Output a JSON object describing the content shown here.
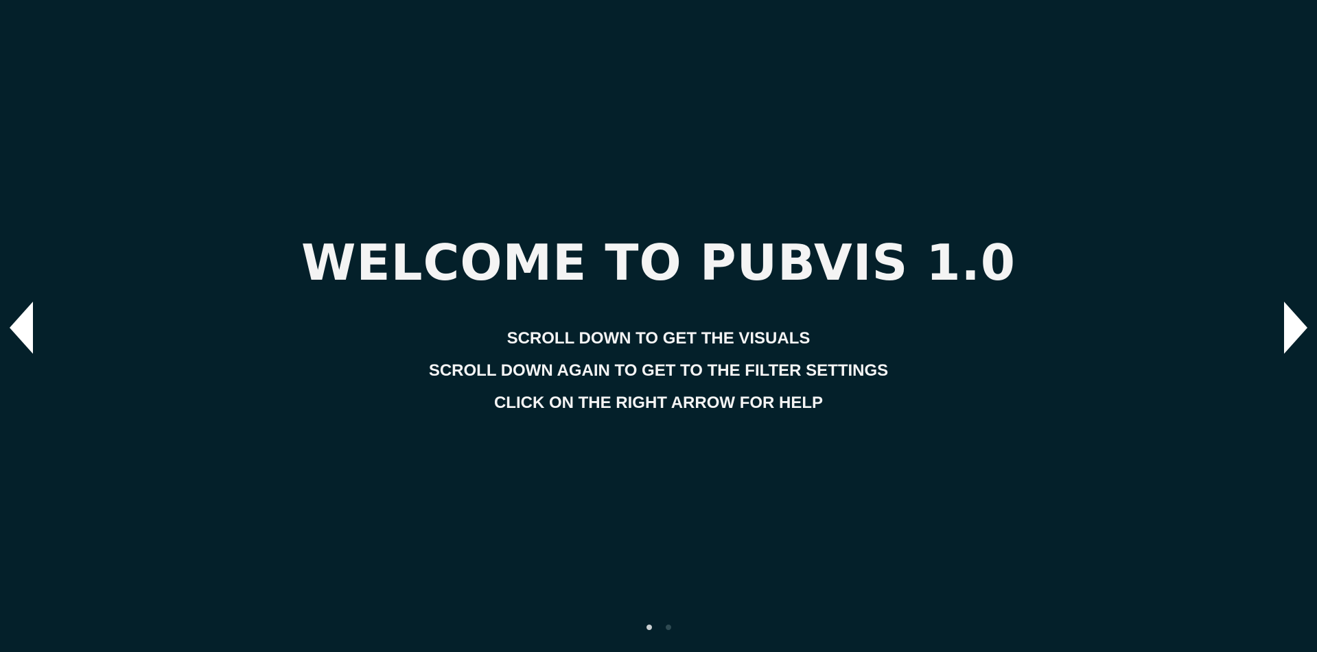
{
  "slide": {
    "title": "Welcome to PubVis 1.0",
    "lines": [
      "Scroll down to get the visuals",
      "Scroll down again to get to the filter settings",
      "Click on the right arrow for help"
    ]
  },
  "navigation": {
    "prev_icon": "triangle-left-icon",
    "next_icon": "triangle-right-icon"
  },
  "pagination": {
    "count": 2,
    "active_index": 0
  },
  "colors": {
    "background": "#04202a",
    "text": "#f4f4f4",
    "dot_active": "#c9cfd1",
    "dot_inactive": "#2e4a52"
  }
}
